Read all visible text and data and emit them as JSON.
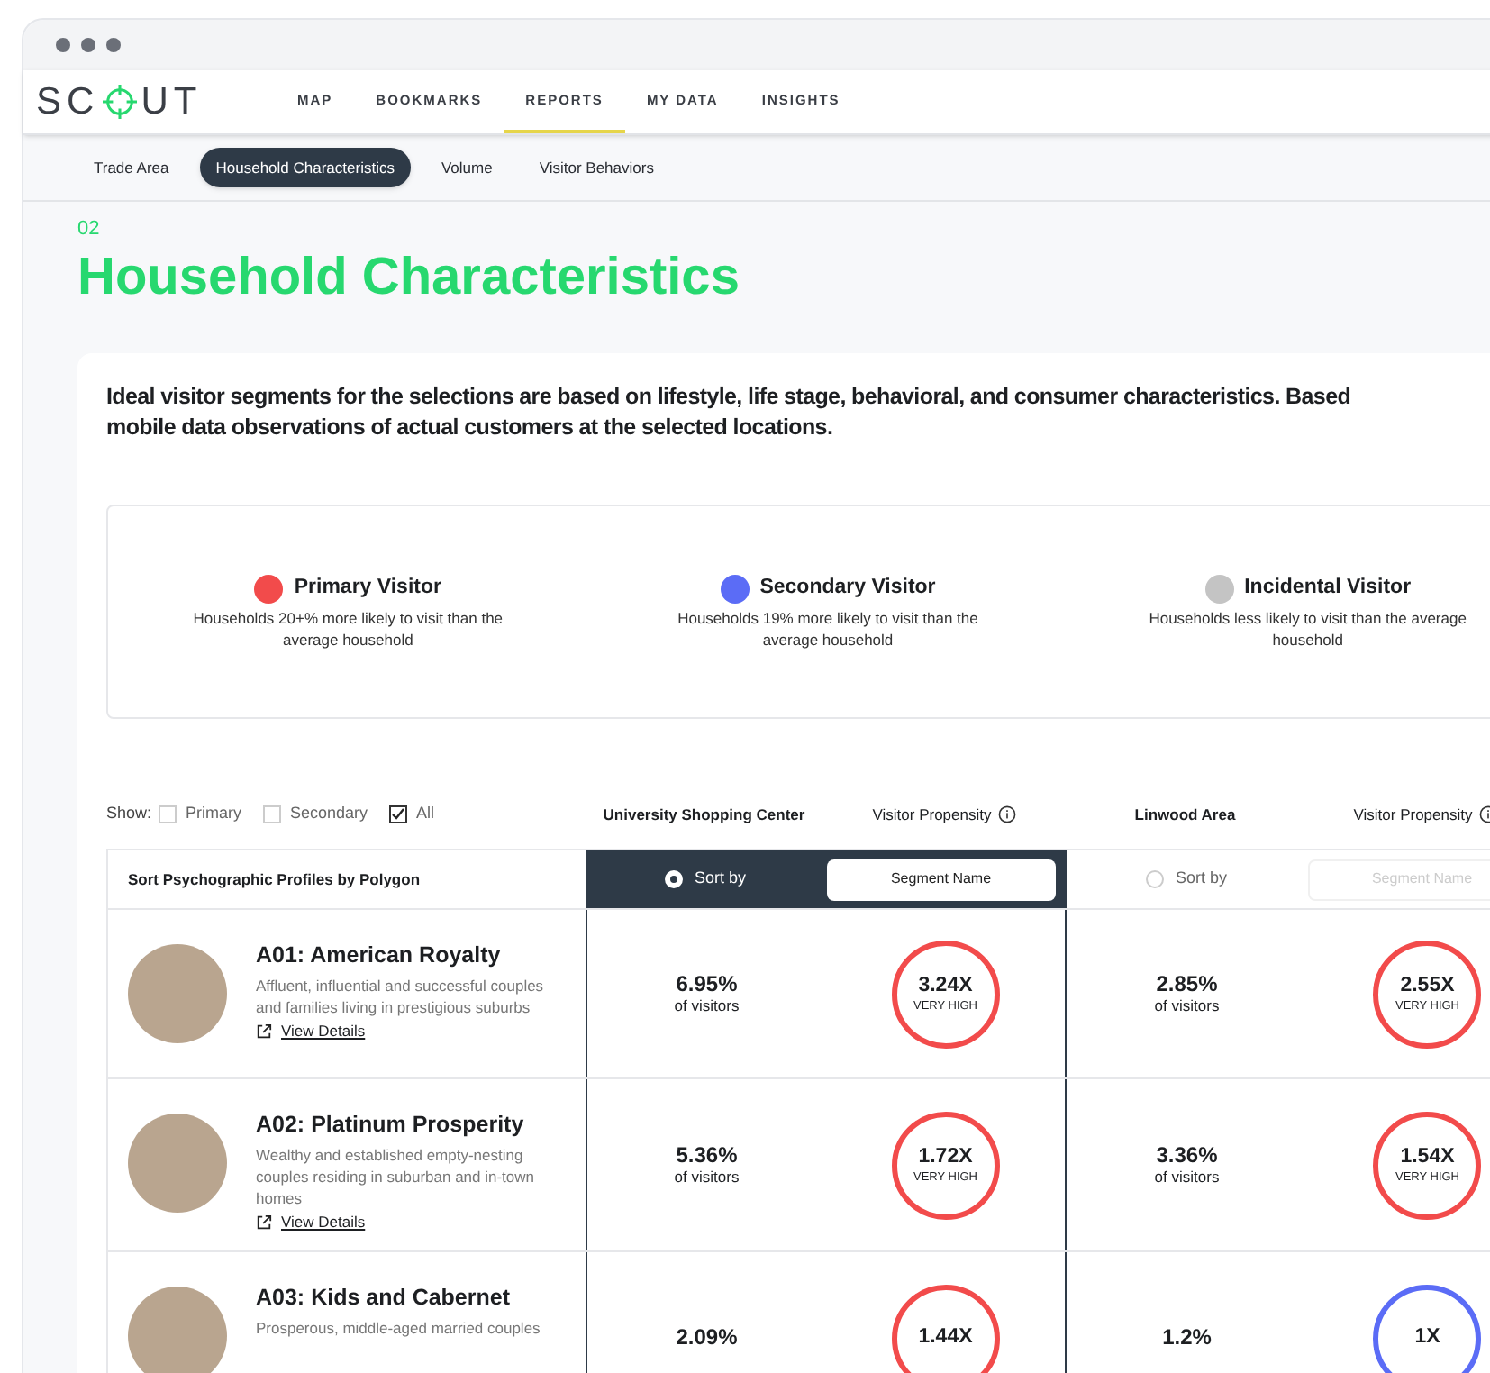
{
  "nav": {
    "logo": [
      "SC",
      "UT"
    ],
    "items": [
      {
        "label": "MAP",
        "selected": false
      },
      {
        "label": "BOOKMARKS",
        "selected": false
      },
      {
        "label": "REPORTS",
        "selected": true
      },
      {
        "label": "MY DATA",
        "selected": false
      },
      {
        "label": "INSIGHTS",
        "selected": false
      }
    ]
  },
  "subtabs": [
    {
      "label": "Trade Area",
      "selected": false
    },
    {
      "label": "Household Characteristics",
      "selected": true
    },
    {
      "label": "Volume",
      "selected": false
    },
    {
      "label": "Visitor Behaviors",
      "selected": false
    }
  ],
  "section": {
    "number": "02",
    "title": "Household Characteristics"
  },
  "description": [
    "Ideal visitor segments for the selections are based on lifestyle, life stage, behavioral, and consumer characteristics. Based",
    "mobile data observations of actual customers at the selected locations."
  ],
  "legend": [
    {
      "name": "Primary Visitor",
      "color": "#f24b4b",
      "text": "Households 20+% more likely to visit than the average household"
    },
    {
      "name": "Secondary Visitor",
      "color": "#5b6cf6",
      "text": "Households 19% more likely to visit than the average household"
    },
    {
      "name": "Incidental Visitor",
      "color": "#c4c4c4",
      "text": "Households less likely to visit than the average household"
    }
  ],
  "filters": {
    "label": "Show:",
    "options": [
      {
        "label": "Primary",
        "checked": false
      },
      {
        "label": "Secondary",
        "checked": false
      },
      {
        "label": "All",
        "checked": true
      }
    ]
  },
  "polygons": [
    {
      "name": "University Shopping Center",
      "metric": "Visitor Propensity",
      "sort_label": "Sort by",
      "sort_field": "Segment Name",
      "selected": true
    },
    {
      "name": "Linwood Area",
      "metric": "Visitor Propensity",
      "sort_label": "Sort by",
      "sort_field": "Segment Name",
      "selected": false
    }
  ],
  "table": {
    "header": "Sort Psychographic Profiles by Polygon",
    "rows": [
      {
        "title": "A01: American Royalty",
        "description": "Affluent, influential and successful couples and families living in prestigious suburbs",
        "link": "View Details",
        "values": [
          {
            "share": "6.95%",
            "share_label": "of visitors",
            "propensity": "3.24X",
            "level_label": "VERY HIGH",
            "color": "#f24b4b"
          },
          {
            "share": "2.85%",
            "share_label": "of visitors",
            "propensity": "2.55X",
            "level_label": "VERY HIGH",
            "color": "#f24b4b"
          }
        ]
      },
      {
        "title": "A02: Platinum Prosperity",
        "description": "Wealthy and established empty-nesting couples residing in suburban and in-town homes",
        "link": "View Details",
        "values": [
          {
            "share": "5.36%",
            "share_label": "of visitors",
            "propensity": "1.72X",
            "level_label": "VERY HIGH",
            "color": "#f24b4b"
          },
          {
            "share": "3.36%",
            "share_label": "of visitors",
            "propensity": "1.54X",
            "level_label": "VERY HIGH",
            "color": "#f24b4b"
          }
        ]
      },
      {
        "title": "A03: Kids and Cabernet",
        "description": "Prosperous, middle-aged married couples",
        "values": [
          {
            "share": "2.09%",
            "propensity": "1.44X",
            "color": "#f24b4b"
          },
          {
            "share": "1.2%",
            "propensity": "1X",
            "color": "#5b6cf6"
          }
        ]
      }
    ]
  }
}
